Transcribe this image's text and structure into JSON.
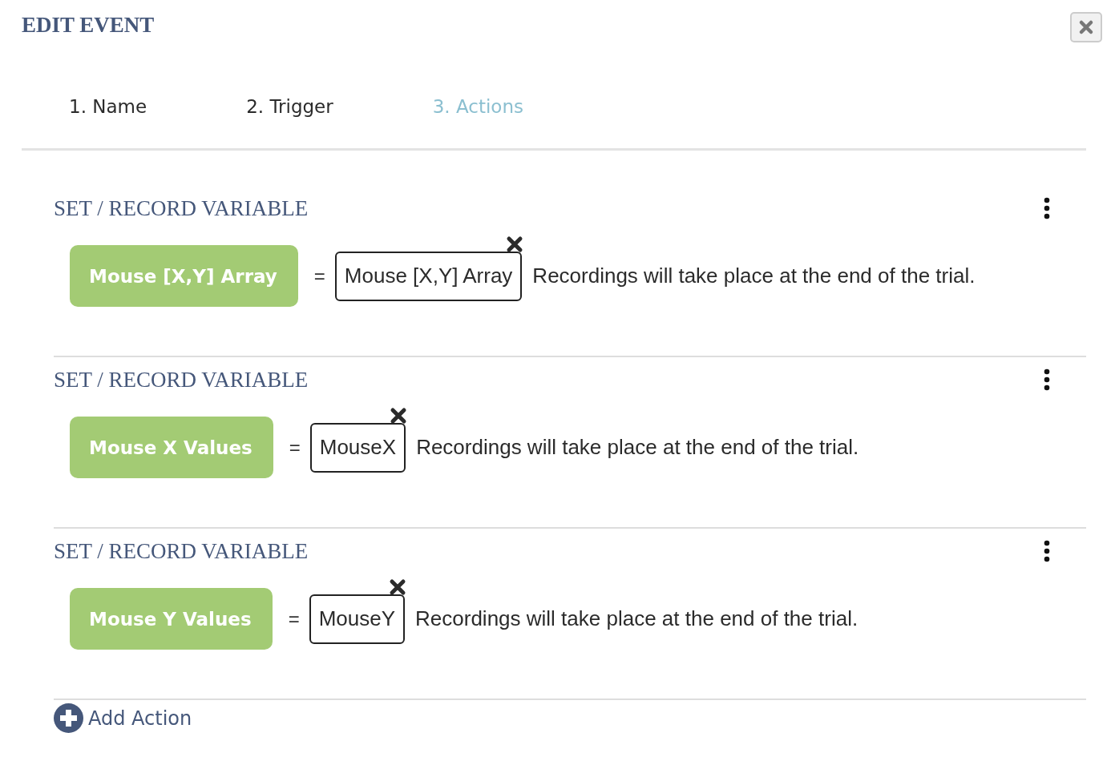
{
  "title": "EDIT EVENT",
  "tabs": [
    {
      "label": "1. Name",
      "selected": false
    },
    {
      "label": "2. Trigger",
      "selected": false
    },
    {
      "label": "3. Actions",
      "selected": true
    }
  ],
  "actions": [
    {
      "heading": "SET / RECORD VARIABLE",
      "variable": "Mouse [X,Y] Array",
      "value": "Mouse [X,Y] Array",
      "note": "Recordings will take place at the end of the trial."
    },
    {
      "heading": "SET / RECORD VARIABLE",
      "variable": "Mouse X Values",
      "value": "MouseX",
      "note": "Recordings will take place at the end of the trial."
    },
    {
      "heading": "SET / RECORD VARIABLE",
      "variable": "Mouse Y Values",
      "value": "MouseY",
      "note": "Recordings will take place at the end of the trial."
    }
  ],
  "equals": "=",
  "add_action": "Add Action"
}
